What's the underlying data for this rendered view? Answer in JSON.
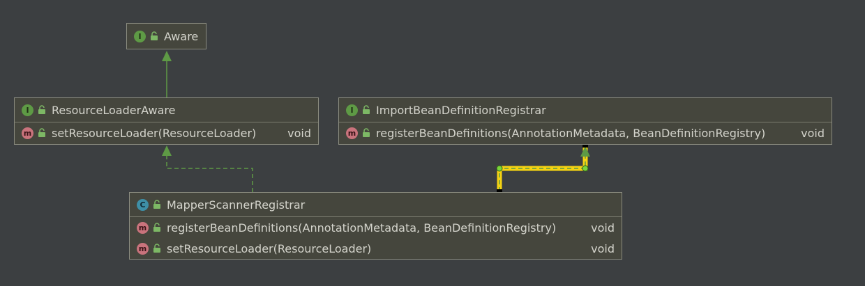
{
  "nodes": {
    "aware": {
      "kind_badge": "I",
      "name": "Aware"
    },
    "resource_loader_aware": {
      "kind_badge": "I",
      "name": "ResourceLoaderAware",
      "methods": [
        {
          "badge": "m",
          "signature": "setResourceLoader(ResourceLoader)",
          "return_type": "void"
        }
      ]
    },
    "import_bean_definition_registrar": {
      "kind_badge": "I",
      "name": "ImportBeanDefinitionRegistrar",
      "methods": [
        {
          "badge": "m",
          "signature": "registerBeanDefinitions(AnnotationMetadata, BeanDefinitionRegistry)",
          "return_type": "void"
        }
      ]
    },
    "mapper_scanner_registrar": {
      "kind_badge": "C",
      "name": "MapperScannerRegistrar",
      "methods": [
        {
          "badge": "m",
          "signature": "registerBeanDefinitions(AnnotationMetadata, BeanDefinitionRegistry)",
          "return_type": "void"
        },
        {
          "badge": "m",
          "signature": "setResourceLoader(ResourceLoader)",
          "return_type": "void"
        }
      ]
    }
  },
  "colors": {
    "background": "#3c3f41",
    "node_fill": "#45463d",
    "node_border": "#8b8c80",
    "edge": "#5e9a45",
    "selected_edge": "#f5d312",
    "interface_badge": "#5e9a45",
    "class_badge": "#3e8fa6",
    "method_badge": "#c9737c"
  },
  "icons": {
    "interface": "interface-icon",
    "class": "class-icon",
    "method": "method-icon",
    "visibility": "public-lock-icon"
  }
}
